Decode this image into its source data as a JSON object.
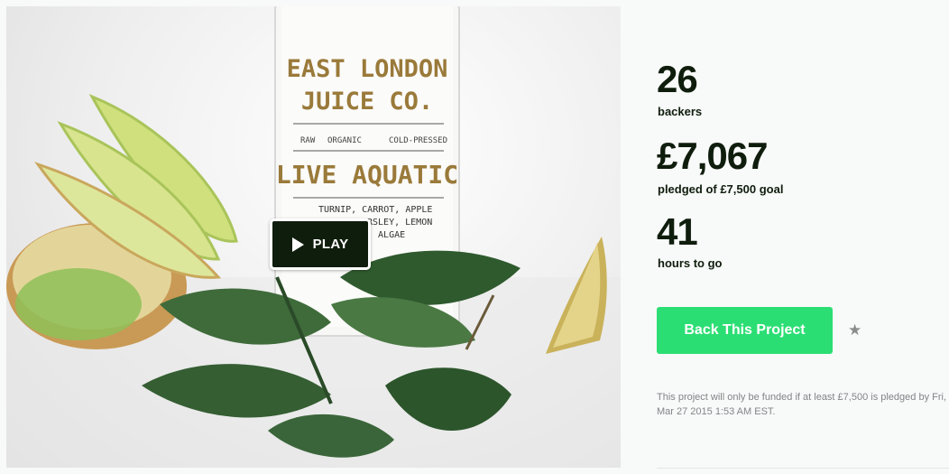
{
  "video": {
    "bottle": {
      "brand_line1": "EAST LONDON",
      "brand_line2": "JUICE CO.",
      "tag_raw": "RAW",
      "tag_organic": "ORGANIC",
      "tag_cold": "COLD-PRESSED",
      "product": "LIVE AQUATIC",
      "ingredients_line1": "TURNIP, CARROT, APPLE",
      "ingredients_line2": "RSLEY, LEMON",
      "ingredients_line3": ", ALGAE"
    },
    "play_label": "PLAY",
    "play_icon": "play-icon"
  },
  "stats": {
    "backers": {
      "value": "26",
      "label": "backers"
    },
    "pledged": {
      "value": "£7,067",
      "label": "pledged of £7,500 goal"
    },
    "hours": {
      "value": "41",
      "label": "hours to go"
    }
  },
  "actions": {
    "back_label": "Back This Project",
    "star_icon": "star-icon"
  },
  "note": "This project will only be funded if at least £7,500 is pledged by Fri, Mar 27 2015 1:53 AM EST.",
  "colors": {
    "accent_green": "#2bde73",
    "dark_text": "#0f1d0d",
    "muted_text": "#828587"
  }
}
